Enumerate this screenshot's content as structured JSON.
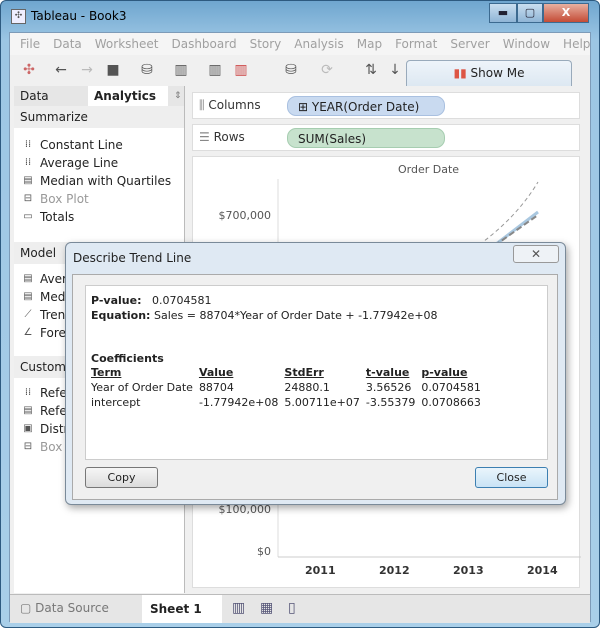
{
  "window": {
    "title": "Tableau - Book3",
    "minimize": "▬",
    "maximize": "▢",
    "close": "X"
  },
  "menu": [
    "File",
    "Data",
    "Worksheet",
    "Dashboard",
    "Story",
    "Analysis",
    "Map",
    "Format",
    "Server",
    "Window",
    "Help"
  ],
  "toolbar": {
    "show_me": "Show Me"
  },
  "left_panel": {
    "tabs": {
      "data": "Data",
      "analytics": "Analytics"
    },
    "summarize": {
      "title": "Summarize",
      "items": [
        "Constant Line",
        "Average Line",
        "Median with Quartiles",
        "Box Plot",
        "Totals"
      ]
    },
    "model": {
      "title": "Model",
      "items": [
        "Aver",
        "Med",
        "Tren",
        "Fore"
      ]
    },
    "custom": {
      "title": "Custom",
      "items": [
        "Refe",
        "Refe",
        "Distr",
        "Box"
      ]
    }
  },
  "shelves": {
    "columns_label": "Columns",
    "columns_pill": "YEAR(Order Date)",
    "rows_label": "Rows",
    "rows_pill": "SUM(Sales)"
  },
  "chart": {
    "header": "Order Date",
    "y_ticks": [
      "$700,000",
      "$100,000",
      "$0"
    ],
    "x_ticks": [
      "2011",
      "2012",
      "2013",
      "2014"
    ]
  },
  "bottom": {
    "data_source": "Data Source",
    "sheet": "Sheet 1"
  },
  "dialog": {
    "title": "Describe Trend Line",
    "close_x": "✕",
    "pvalue_label": "P-value:",
    "pvalue": "0.0704581",
    "equation_label": "Equation:",
    "equation": "Sales = 88704*Year of Order Date + -1.77942e+08",
    "coefficients_title": "Coefficients",
    "headers": [
      "Term",
      "Value",
      "StdErr",
      "t-value",
      "p-value"
    ],
    "rows": [
      [
        "Year of Order Date",
        "88704",
        "24880.1",
        "3.56526",
        "0.0704581"
      ],
      [
        "intercept",
        "-1.77942e+08",
        "5.00711e+07",
        "-3.55379",
        "0.0708663"
      ]
    ],
    "copy": "Copy",
    "close": "Close"
  }
}
